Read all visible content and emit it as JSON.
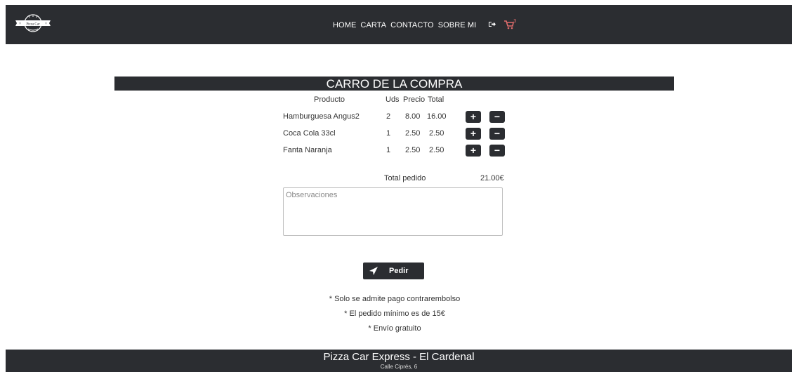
{
  "header": {
    "logo_text": "Pizza Car",
    "nav": [
      "HOME",
      "CARTA",
      "CONTACTO",
      "SOBRE MI"
    ],
    "cart_count": "3"
  },
  "cart": {
    "title": "CARRO DE LA COMPRA",
    "columns": [
      "Producto",
      "Uds",
      "Precio",
      "Total"
    ],
    "rows": [
      {
        "product": "Hamburguesa Angus2",
        "units": "2",
        "price": "8.00",
        "total": "16.00"
      },
      {
        "product": "Coca Cola 33cl",
        "units": "1",
        "price": "2.50",
        "total": "2.50"
      },
      {
        "product": "Fanta Naranja",
        "units": "1",
        "price": "2.50",
        "total": "2.50"
      }
    ],
    "plus_label": "+",
    "minus_label": "−",
    "total_label": "Total pedido",
    "total_value": "21.00€",
    "observations_placeholder": "Observaciones",
    "order_button": "Pedir",
    "notes": [
      "* Solo se admite pago contrarembolso",
      "* El pedido mínimo es de 15€",
      "* Envío gratuito"
    ]
  },
  "footer": {
    "brand": "Pizza Car Express - El Cardenal",
    "address": "Calle Ciprés, 6"
  },
  "colors": {
    "dark": "#2b2d31",
    "cart_accent": "#e06c6c"
  }
}
